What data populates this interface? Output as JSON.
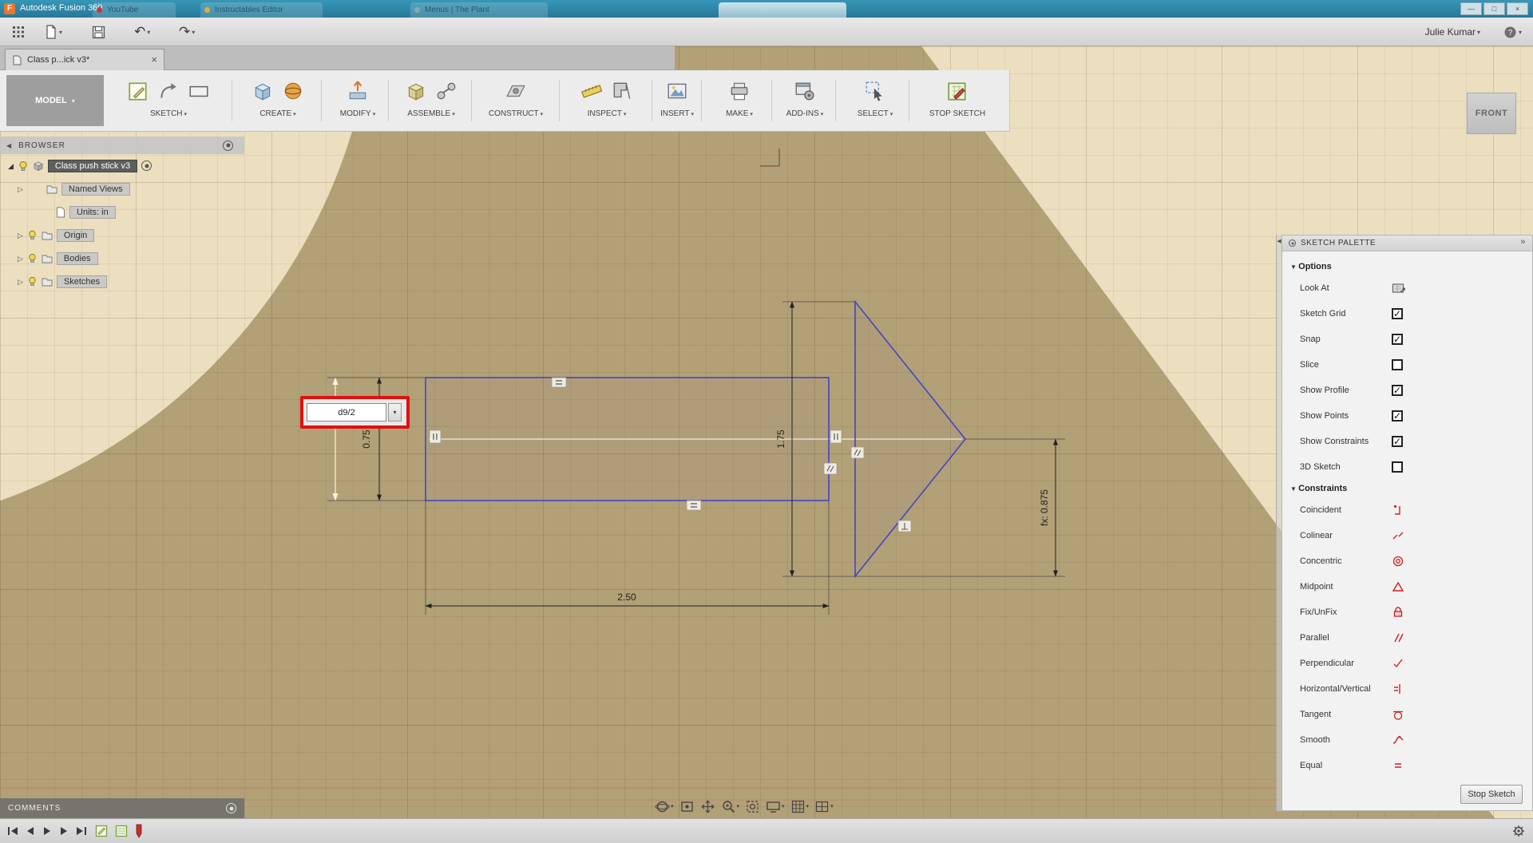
{
  "title_bar": {
    "app_title": "Autodesk Fusion 360",
    "background_tabs": [
      {
        "label": "YouTube"
      },
      {
        "label": "Instructables Editor"
      },
      {
        "label": "Menus | The Plant"
      },
      {
        "label": ""
      }
    ]
  },
  "quick_toolbar": {
    "user_name": "Julie Kumar"
  },
  "document_tab": {
    "label": "Class p...ick v3*"
  },
  "ribbon": {
    "model_label": "MODEL",
    "groups": [
      {
        "label": "SKETCH"
      },
      {
        "label": "CREATE"
      },
      {
        "label": "MODIFY"
      },
      {
        "label": "ASSEMBLE"
      },
      {
        "label": "CONSTRUCT"
      },
      {
        "label": "INSPECT"
      },
      {
        "label": "INSERT"
      },
      {
        "label": "MAKE"
      },
      {
        "label": "ADD-INS"
      },
      {
        "label": "SELECT"
      },
      {
        "label": "STOP SKETCH"
      }
    ]
  },
  "browser": {
    "header": "BROWSER",
    "root_label": "Class push stick v3",
    "items": [
      {
        "label": "Named Views"
      },
      {
        "label": "Units: in"
      },
      {
        "label": "Origin"
      },
      {
        "label": "Bodies"
      },
      {
        "label": "Sketches"
      }
    ]
  },
  "canvas": {
    "viewcube_label": "FRONT",
    "dim_input_value": "d9/2",
    "dimensions": {
      "rect_height": "0.75",
      "arrow_height": "1.75",
      "rect_width": "2.50",
      "fx_value": "fx: 0.875"
    }
  },
  "sketch_palette": {
    "header": "SKETCH PALETTE",
    "options_header": "Options",
    "options": [
      {
        "label": "Look At",
        "control": "look-at-icon"
      },
      {
        "label": "Sketch Grid",
        "checked": true
      },
      {
        "label": "Snap",
        "checked": true
      },
      {
        "label": "Slice",
        "checked": false
      },
      {
        "label": "Show Profile",
        "checked": true
      },
      {
        "label": "Show Points",
        "checked": true
      },
      {
        "label": "Show Constraints",
        "checked": true
      },
      {
        "label": "3D Sketch",
        "checked": false
      }
    ],
    "constraints_header": "Constraints",
    "constraints": [
      {
        "label": "Coincident"
      },
      {
        "label": "Colinear"
      },
      {
        "label": "Concentric"
      },
      {
        "label": "Midpoint"
      },
      {
        "label": "Fix/UnFix"
      },
      {
        "label": "Parallel"
      },
      {
        "label": "Perpendicular"
      },
      {
        "label": "Horizontal/Vertical"
      },
      {
        "label": "Tangent"
      },
      {
        "label": "Smooth"
      },
      {
        "label": "Equal"
      }
    ],
    "stop_sketch_label": "Stop Sketch"
  },
  "comments": {
    "label": "COMMENTS"
  },
  "colors": {
    "titlebar_teal": "#2e8cab",
    "canvas_tan": "#b2a077",
    "canvas_cream": "#ecdfc0",
    "sketch_blue": "#4444c4",
    "constraint_red": "#cc2222",
    "annotation_red": "#e01010"
  }
}
